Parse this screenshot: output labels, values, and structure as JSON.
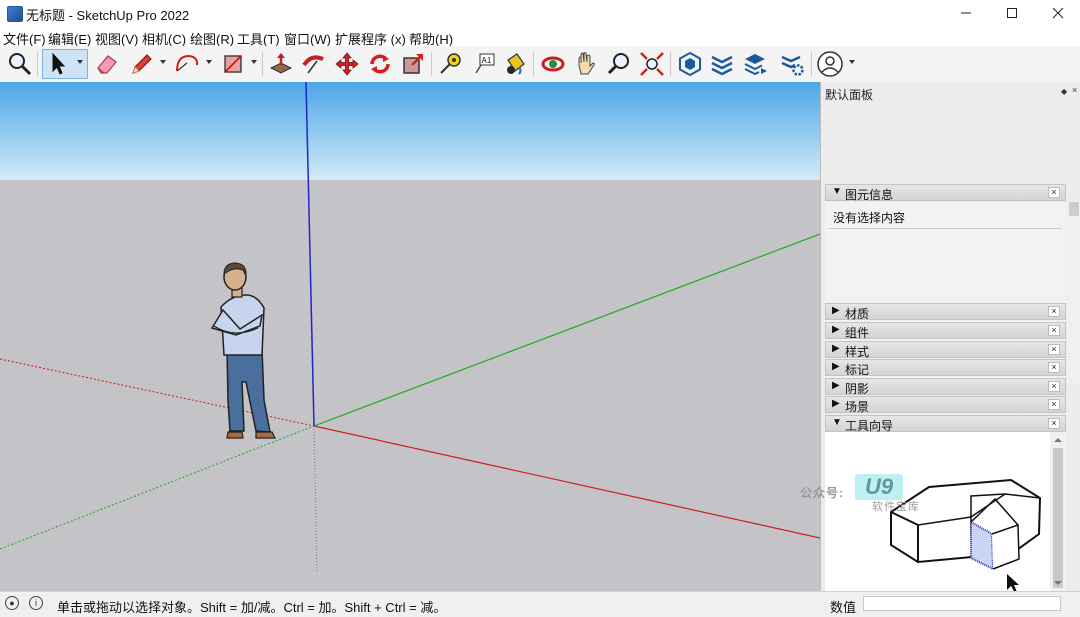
{
  "window": {
    "title": "无标题 - SketchUp Pro 2022",
    "controls": {
      "minimize": "—",
      "maximize": "☐",
      "close": "✕"
    }
  },
  "menu": [
    {
      "label": "文件(F)"
    },
    {
      "label": "编辑(E)"
    },
    {
      "label": "视图(V)"
    },
    {
      "label": "相机(C)"
    },
    {
      "label": "绘图(R)"
    },
    {
      "label": "工具(T)"
    },
    {
      "label": "窗口(W)"
    },
    {
      "label": "扩展程序 (x)"
    },
    {
      "label": "帮助(H)"
    }
  ],
  "toolbar": {
    "tools": [
      "search-icon",
      "select-icon",
      "eraser-icon",
      "pencil-icon",
      "arc-icon",
      "rectangle-icon",
      "push-pull-icon",
      "follow-me-icon",
      "move-icon",
      "rotate-icon",
      "scale-icon",
      "tape-measure-icon",
      "text-icon",
      "paint-bucket-icon",
      "orbit-icon",
      "pan-icon",
      "zoom-icon",
      "zoom-extents-icon",
      "warehouse-icon",
      "extension-warehouse-icon",
      "layout-icon",
      "extension-manager-icon",
      "account-icon"
    ]
  },
  "viewport": {
    "sky_color_top": "#4aa6e8",
    "sky_color_bottom": "#d4ebf7",
    "ground_color": "#c3c3c8",
    "axis_colors": {
      "red": "#cc2020",
      "green": "#22aa22",
      "blue": "#2424cc"
    }
  },
  "tray": {
    "title": "默认面板",
    "pin": "◆",
    "close": "×",
    "entity_info": {
      "arrow": "▼",
      "label": "图元信息",
      "close": "×",
      "content": "没有选择内容"
    },
    "panels": [
      {
        "arrow": "▶",
        "label": "材质",
        "close": "×"
      },
      {
        "arrow": "▶",
        "label": "组件",
        "close": "×"
      },
      {
        "arrow": "▶",
        "label": "样式",
        "close": "×"
      },
      {
        "arrow": "▶",
        "label": "标记",
        "close": "×"
      },
      {
        "arrow": "▶",
        "label": "阴影",
        "close": "×"
      },
      {
        "arrow": "▶",
        "label": "场景",
        "close": "×"
      }
    ],
    "instructor": {
      "arrow": "▼",
      "label": "工具向导",
      "close": "×"
    }
  },
  "watermark": {
    "prefix": "公众号:",
    "logo": "U9",
    "subtitle": "软件宝库"
  },
  "status": {
    "message": "单击或拖动以选择对象。Shift = 加/减。Ctrl = 加。Shift + Ctrl = 减。",
    "vcb_label": "数值",
    "vcb_value": ""
  }
}
